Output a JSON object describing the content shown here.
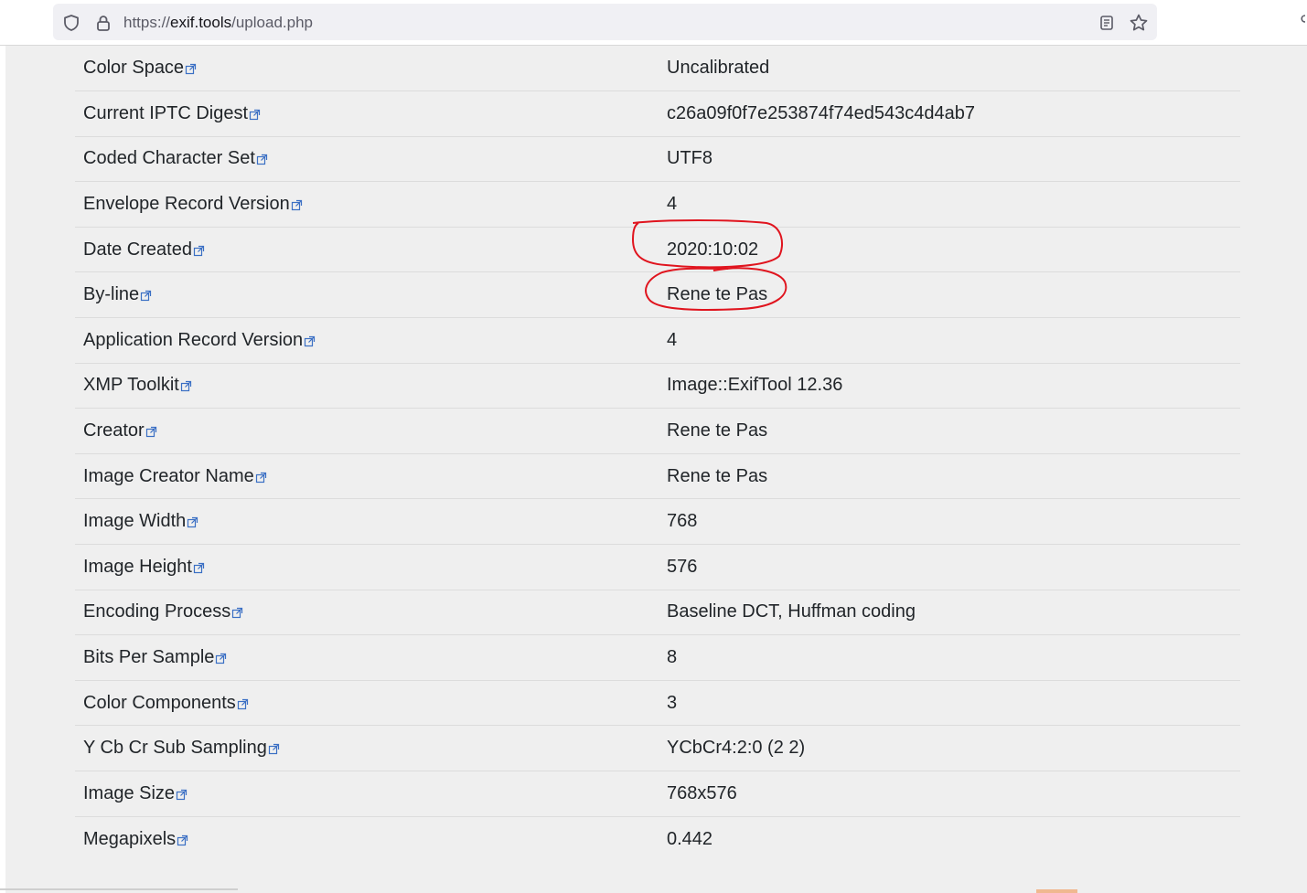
{
  "browser": {
    "url_scheme": "https://",
    "url_host": "exif.tools",
    "url_path": "/upload.php",
    "icons": [
      "shield-icon",
      "lock-icon",
      "reader-view-icon",
      "bookmark-star-icon"
    ]
  },
  "exif_table": {
    "rows": [
      {
        "key": "Color Space",
        "value": "Uncalibrated"
      },
      {
        "key": "Current IPTC Digest",
        "value": "c26a09f0f7e253874f74ed543c4d4ab7"
      },
      {
        "key": "Coded Character Set",
        "value": "UTF8"
      },
      {
        "key": "Envelope Record Version",
        "value": "4"
      },
      {
        "key": "Date Created",
        "value": "2020:10:02"
      },
      {
        "key": "By-line",
        "value": "Rene te Pas"
      },
      {
        "key": "Application Record Version",
        "value": "4"
      },
      {
        "key": "XMP Toolkit",
        "value": "Image::ExifTool 12.36"
      },
      {
        "key": "Creator",
        "value": "Rene te Pas"
      },
      {
        "key": "Image Creator Name",
        "value": "Rene te Pas"
      },
      {
        "key": "Image Width",
        "value": "768"
      },
      {
        "key": "Image Height",
        "value": "576"
      },
      {
        "key": "Encoding Process",
        "value": "Baseline DCT, Huffman coding"
      },
      {
        "key": "Bits Per Sample",
        "value": "8"
      },
      {
        "key": "Color Components",
        "value": "3"
      },
      {
        "key": "Y Cb Cr Sub Sampling",
        "value": "YCbCr4:2:0 (2 2)"
      },
      {
        "key": "Image Size",
        "value": "768x576"
      },
      {
        "key": "Megapixels",
        "value": "0.442"
      }
    ]
  },
  "colors": {
    "link_icon": "#3a6fc4",
    "annotation": "#e0141e"
  }
}
